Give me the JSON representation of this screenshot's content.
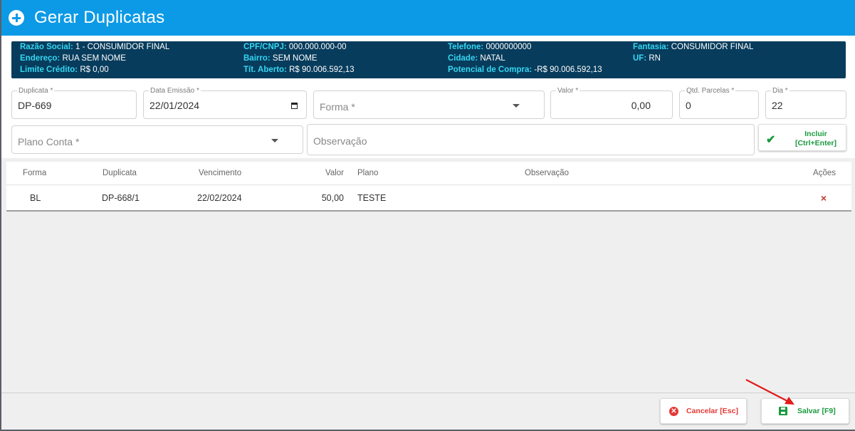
{
  "header": {
    "title": "Gerar Duplicatas",
    "icon": "plus-circle-icon"
  },
  "customer": {
    "razao_social_label": "Razão Social:",
    "razao_social": "1 - CONSUMIDOR FINAL",
    "endereco_label": "Endereço:",
    "endereco": "RUA SEM NOME",
    "limite_label": "Limite Crédito:",
    "limite": "R$ 0,00",
    "cpf_label": "CPF/CNPJ:",
    "cpf": "000.000.000-00",
    "bairro_label": "Bairro:",
    "bairro": "SEM NOME",
    "tit_label": "Tít. Aberto:",
    "tit": "R$ 90.006.592,13",
    "telefone_label": "Telefone:",
    "telefone": "0000000000",
    "cidade_label": "Cidade:",
    "cidade": "NATAL",
    "potencial_label": "Potencial de Compra:",
    "potencial": "-R$ 90.006.592,13",
    "fantasia_label": "Fantasia:",
    "fantasia": "CONSUMIDOR FINAL",
    "uf_label": "UF:",
    "uf": "RN"
  },
  "form": {
    "duplicata_label": "Duplicata *",
    "duplicata": "DP-669",
    "data_label": "Data Emissão *",
    "data": "22/01/2024",
    "forma_placeholder": "Forma *",
    "valor_label": "Valor *",
    "valor": "0,00",
    "parcelas_label": "Qtd. Parcelas *",
    "parcelas": "0",
    "dia_label": "Dia *",
    "dia": "22",
    "plano_placeholder": "Plano Conta *",
    "obs_placeholder": "Observação",
    "incluir_label": "Incluir",
    "incluir_shortcut": "[Ctrl+Enter]"
  },
  "table": {
    "columns": [
      "Forma",
      "Duplicata",
      "Vencimento",
      "Valor",
      "Plano",
      "Observação",
      "Ações"
    ],
    "rows": [
      {
        "forma": "BL",
        "duplicata": "DP-668/1",
        "vencimento": "22/02/2024",
        "valor": "50,00",
        "plano": "TESTE",
        "observacao": "",
        "acao": "×"
      }
    ]
  },
  "footer": {
    "cancel_label": "Cancelar [Esc]",
    "save_label": "Salvar [F9]"
  },
  "colors": {
    "header": "#0c9ae6",
    "info_bg": "#073c5c",
    "info_label": "#35d6f2",
    "save": "#1a9a3f",
    "cancel": "#e53935",
    "arrow": "#e31b1b"
  }
}
